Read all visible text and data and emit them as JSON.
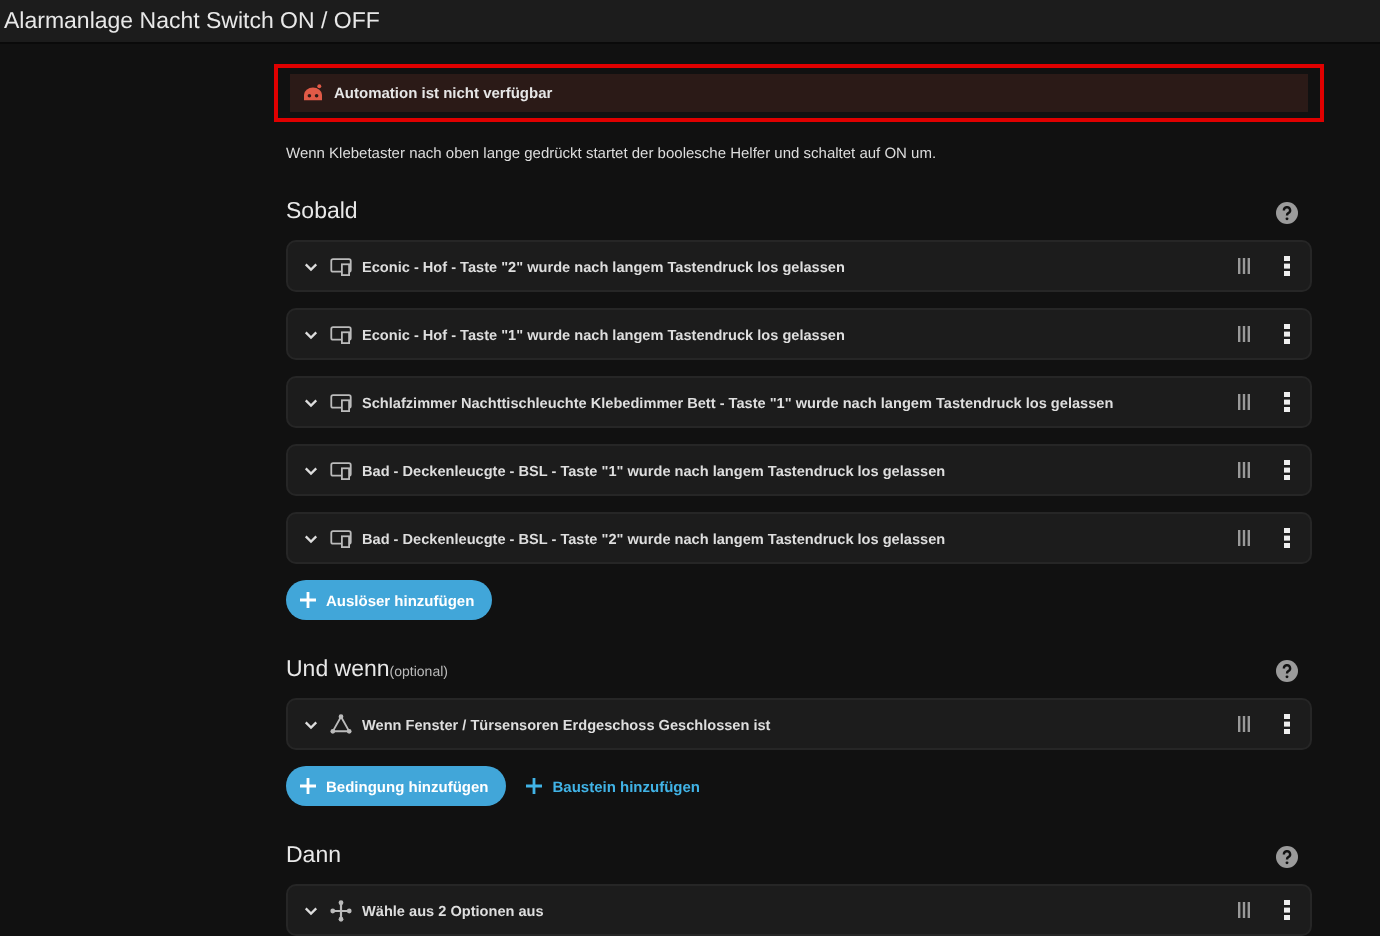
{
  "window": {
    "title": "Alarmanlage Nacht Switch ON / OFF"
  },
  "alert": {
    "text": "Automation ist nicht verfügbar",
    "highlighted": true
  },
  "description": "Wenn Klebetaster nach oben lange gedrückt startet der boolesche Helfer und schaltet auf ON um.",
  "sections": [
    {
      "heading": "Sobald",
      "items": [
        {
          "kind": "device",
          "label": "Econic - Hof - Taste \"2\" wurde nach langem Tastendruck los gelassen"
        },
        {
          "kind": "device",
          "label": "Econic - Hof - Taste \"1\" wurde nach langem Tastendruck los gelassen"
        },
        {
          "kind": "device",
          "label": "Schlafzimmer Nachttischleuchte Klebedimmer Bett - Taste \"1\" wurde nach langem Tastendruck los gelassen"
        },
        {
          "kind": "device",
          "label": "Bad - Deckenleucgte - BSL - Taste \"1\" wurde nach langem Tastendruck los gelassen"
        },
        {
          "kind": "device",
          "label": "Bad - Deckenleucgte - BSL - Taste \"2\" wurde nach langem Tastendruck los gelassen"
        }
      ],
      "buttons": [
        {
          "kind": "filled",
          "label": "Auslöser hinzufügen"
        }
      ]
    },
    {
      "heading": "Und wenn",
      "note": "(optional)",
      "items": [
        {
          "kind": "condition",
          "label": "Wenn Fenster / Türsensoren Erdgeschoss Geschlossen ist"
        }
      ],
      "buttons": [
        {
          "kind": "filled",
          "label": "Bedingung hinzufügen"
        },
        {
          "kind": "text",
          "label": "Baustein hinzufügen"
        }
      ]
    },
    {
      "heading": "Dann",
      "items": [
        {
          "kind": "choose",
          "label": "Wähle aus 2 Optionen aus"
        }
      ]
    }
  ]
}
